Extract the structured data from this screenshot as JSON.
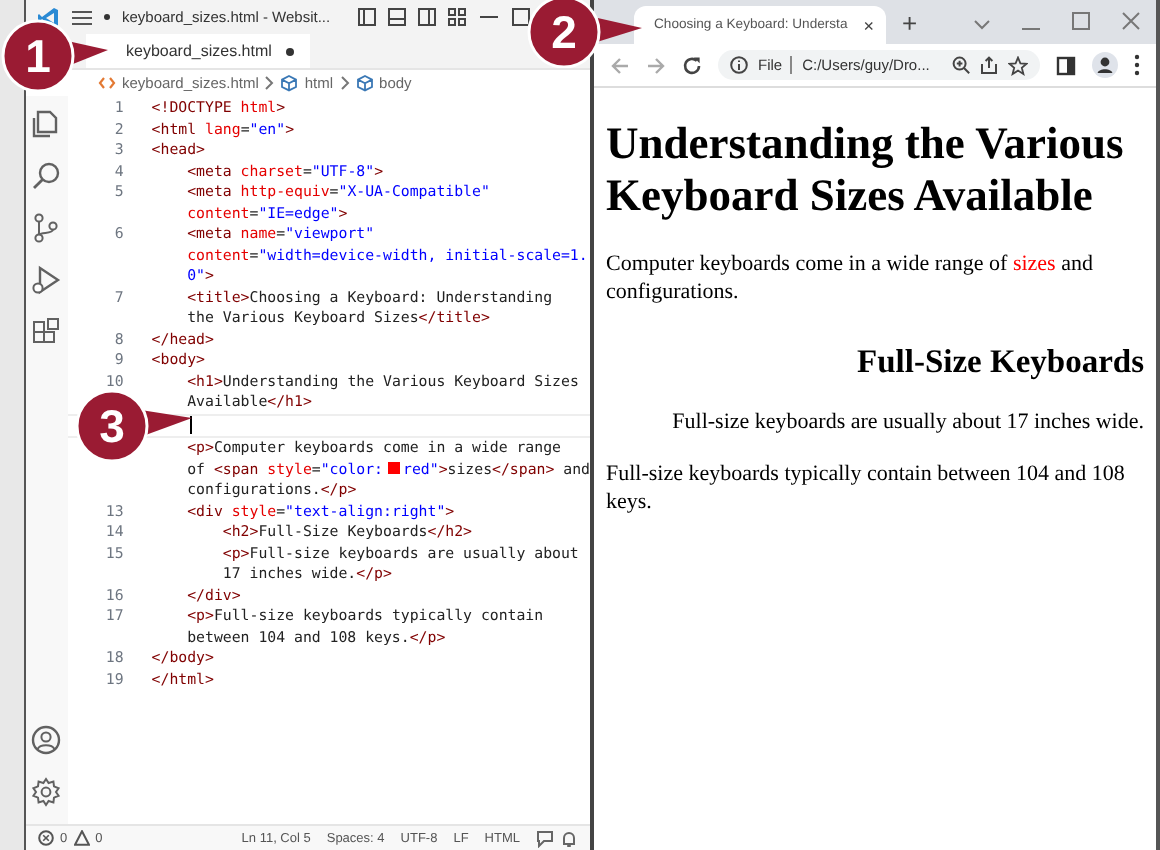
{
  "callouts": [
    {
      "number": "1"
    },
    {
      "number": "2"
    },
    {
      "number": "3"
    }
  ],
  "editor": {
    "title": "keyboard_sizes.html - Websit...",
    "title_modified": true,
    "tab": {
      "label": "keyboard_sizes.html",
      "modified": true,
      "selected": true
    },
    "breadcrumbs": [
      "keyboard_sizes.html",
      "html",
      "body"
    ],
    "lines": [
      {
        "number": "1",
        "cursor": false,
        "tokens": [
          {
            "kind": "tag",
            "text": "<!DOCTYPE "
          },
          {
            "kind": "attr",
            "text": "html"
          },
          {
            "kind": "tag",
            "text": ">"
          }
        ]
      },
      {
        "number": "2",
        "cursor": false,
        "tokens": [
          {
            "kind": "tag",
            "text": "<html "
          },
          {
            "kind": "attr",
            "text": "lang"
          },
          {
            "kind": "text",
            "text": "="
          },
          {
            "kind": "value",
            "text": "\"en\""
          },
          {
            "kind": "tag",
            "text": ">"
          }
        ]
      },
      {
        "number": "3",
        "cursor": false,
        "tokens": [
          {
            "kind": "tag",
            "text": "<head>"
          }
        ]
      },
      {
        "number": "4",
        "cursor": false,
        "tokens": [
          {
            "kind": "tag",
            "text": "    <meta "
          },
          {
            "kind": "attr",
            "text": "charset"
          },
          {
            "kind": "text",
            "text": "="
          },
          {
            "kind": "value",
            "text": "\"UTF-8\""
          },
          {
            "kind": "tag",
            "text": ">"
          }
        ]
      },
      {
        "number": "5",
        "cursor": false,
        "tokens": [
          {
            "kind": "tag",
            "text": "    <meta "
          },
          {
            "kind": "attr",
            "text": "http-equiv"
          },
          {
            "kind": "text",
            "text": "="
          },
          {
            "kind": "value",
            "text": "\"X-UA-Compatible\""
          }
        ]
      },
      {
        "cursor": false,
        "tokens": [
          {
            "kind": "attr",
            "text": "    content"
          },
          {
            "kind": "text",
            "text": "="
          },
          {
            "kind": "value",
            "text": "\"IE=edge\""
          },
          {
            "kind": "tag",
            "text": ">"
          }
        ]
      },
      {
        "number": "6",
        "cursor": false,
        "tokens": [
          {
            "kind": "tag",
            "text": "    <meta "
          },
          {
            "kind": "attr",
            "text": "name"
          },
          {
            "kind": "text",
            "text": "="
          },
          {
            "kind": "value",
            "text": "\"viewport\""
          }
        ]
      },
      {
        "cursor": false,
        "tokens": [
          {
            "kind": "attr",
            "text": "    content"
          },
          {
            "kind": "text",
            "text": "="
          },
          {
            "kind": "value",
            "text": "\"width=device-width, initial-scale=1."
          }
        ]
      },
      {
        "cursor": false,
        "tokens": [
          {
            "kind": "value",
            "text": "    0\""
          },
          {
            "kind": "tag",
            "text": ">"
          }
        ]
      },
      {
        "number": "7",
        "cursor": false,
        "tokens": [
          {
            "kind": "tag",
            "text": "    <title>"
          },
          {
            "kind": "text",
            "text": "Choosing a Keyboard: Understanding"
          }
        ]
      },
      {
        "cursor": false,
        "tokens": [
          {
            "kind": "text",
            "text": "    the Various Keyboard Sizes"
          },
          {
            "kind": "tag",
            "text": "</title>"
          }
        ]
      },
      {
        "number": "8",
        "cursor": false,
        "tokens": [
          {
            "kind": "tag",
            "text": "</head>"
          }
        ]
      },
      {
        "number": "9",
        "cursor": false,
        "tokens": [
          {
            "kind": "tag",
            "text": "<body>"
          }
        ]
      },
      {
        "number": "10",
        "cursor": false,
        "tokens": [
          {
            "kind": "tag",
            "text": "    <h1>"
          },
          {
            "kind": "text",
            "text": "Understanding the Various Keyboard Sizes"
          }
        ]
      },
      {
        "cursor": false,
        "tokens": [
          {
            "kind": "text",
            "text": "    Available"
          },
          {
            "kind": "tag",
            "text": "</h1>"
          }
        ]
      },
      {
        "cursor": true
      },
      {
        "cursor": false,
        "tokens": [
          {
            "kind": "tag",
            "text": "    <p>"
          },
          {
            "kind": "text",
            "text": "Computer keyboards come in a wide range"
          }
        ]
      },
      {
        "cursor": false,
        "tokens": [
          {
            "kind": "text",
            "text": "    of "
          },
          {
            "kind": "tag",
            "text": "<span "
          },
          {
            "kind": "attr",
            "text": "style"
          },
          {
            "kind": "text",
            "text": "="
          },
          {
            "kind": "value",
            "text": "\"color:"
          },
          {
            "kind": "swatch",
            "color": "#ff0000"
          },
          {
            "kind": "value",
            "text": "red\""
          },
          {
            "kind": "tag",
            "text": ">"
          },
          {
            "kind": "text",
            "text": "sizes"
          },
          {
            "kind": "tag",
            "text": "</span>"
          },
          {
            "kind": "text",
            "text": " and"
          }
        ]
      },
      {
        "cursor": false,
        "tokens": [
          {
            "kind": "text",
            "text": "    configurations."
          },
          {
            "kind": "tag",
            "text": "</p>"
          }
        ]
      },
      {
        "number": "13",
        "cursor": false,
        "tokens": [
          {
            "kind": "tag",
            "text": "    <div "
          },
          {
            "kind": "attr",
            "text": "style"
          },
          {
            "kind": "text",
            "text": "="
          },
          {
            "kind": "value",
            "text": "\"text-align:right\""
          },
          {
            "kind": "tag",
            "text": ">"
          }
        ]
      },
      {
        "number": "14",
        "cursor": false,
        "tokens": [
          {
            "kind": "tag",
            "text": "        <h2>"
          },
          {
            "kind": "text",
            "text": "Full-Size Keyboards"
          },
          {
            "kind": "tag",
            "text": "</h2>"
          }
        ]
      },
      {
        "number": "15",
        "cursor": false,
        "tokens": [
          {
            "kind": "tag",
            "text": "        <p>"
          },
          {
            "kind": "text",
            "text": "Full-size keyboards are usually about"
          }
        ]
      },
      {
        "cursor": false,
        "tokens": [
          {
            "kind": "text",
            "text": "        17 inches wide."
          },
          {
            "kind": "tag",
            "text": "</p>"
          }
        ]
      },
      {
        "number": "16",
        "cursor": false,
        "tokens": [
          {
            "kind": "tag",
            "text": "    </div>"
          }
        ]
      },
      {
        "number": "17",
        "cursor": false,
        "tokens": [
          {
            "kind": "tag",
            "text": "    <p>"
          },
          {
            "kind": "text",
            "text": "Full-size keyboards typically contain"
          }
        ]
      },
      {
        "cursor": false,
        "tokens": [
          {
            "kind": "text",
            "text": "    between 104 and 108 keys."
          },
          {
            "kind": "tag",
            "text": "</p>"
          }
        ]
      },
      {
        "number": "18",
        "cursor": false,
        "tokens": [
          {
            "kind": "tag",
            "text": "</body>"
          }
        ]
      },
      {
        "number": "19",
        "cursor": false,
        "tokens": [
          {
            "kind": "tag",
            "text": "</html>"
          }
        ]
      }
    ],
    "status": {
      "errors": "0",
      "warnings": "0",
      "items": [
        "Ln 11, Col 5",
        "Spaces: 4",
        "UTF-8",
        "LF",
        "HTML"
      ]
    }
  },
  "browser": {
    "tab": {
      "title": "Choosing a Keyboard: Understa",
      "close": "×",
      "selected": true
    },
    "new_tab": "+",
    "address": {
      "scheme": "File",
      "url": "C:/Users/guy/Dro..."
    },
    "page": {
      "heading": "Understanding the Various Keyboard Sizes Available",
      "intro": [
        {
          "text": "Computer keyboards come in a wide range of "
        },
        {
          "text": "sizes",
          "color": "#ff0000"
        },
        {
          "text": " and configurations."
        }
      ],
      "subheading": "Full-Size Keyboards",
      "right_paragraph": "Full-size keyboards are usually about 17 inches wide.",
      "paragraph": "Full-size keyboards typically contain between 104 and 108 keys."
    }
  }
}
